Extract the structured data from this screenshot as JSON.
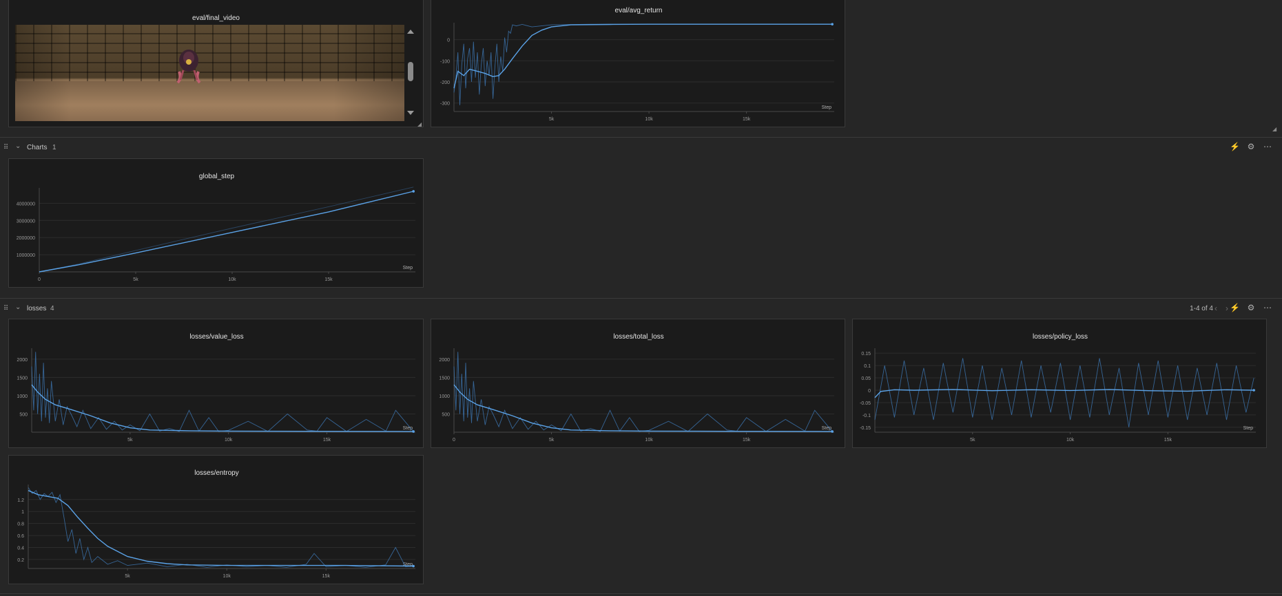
{
  "sections": {
    "charts": {
      "name": "Charts",
      "count": "1"
    },
    "losses": {
      "name": "losses",
      "count": "4",
      "pager": "1-4 of 4"
    }
  },
  "icons": {
    "drag": "drag-handle-icon",
    "collapse": "chevron-down-icon",
    "edit": "magic-wand-icon",
    "settings": "gear-icon",
    "more": "more-icon",
    "prev": "chevron-left-icon",
    "next": "chevron-right-icon"
  },
  "colors": {
    "line": "#5ba3e8",
    "raw": "#3d78b5",
    "background": "#262626",
    "panel": "#1b1b1b"
  },
  "video_panel": {
    "title": "eval/final_video"
  },
  "chart_data": [
    {
      "id": "avg_return",
      "type": "line",
      "title": "eval/avg_return",
      "xlabel": "Step",
      "xlim": [
        0,
        19500
      ],
      "ylim": [
        -340,
        80
      ],
      "xticks": [
        "5k",
        "10k",
        "15k"
      ],
      "xtick_values": [
        5000,
        10000,
        15000
      ],
      "yticks": [
        "0",
        "-100",
        "-200",
        "-300"
      ],
      "ytick_values": [
        0,
        -100,
        -200,
        -300
      ],
      "series": [
        {
          "role": "smoothed",
          "x": [
            0,
            200,
            500,
            800,
            1200,
            1600,
            2000,
            2300,
            2600,
            3000,
            3500,
            4000,
            4500,
            5000,
            6000,
            8000,
            10000,
            13000,
            16000,
            19400
          ],
          "y": [
            -230,
            -150,
            -170,
            -140,
            -150,
            -160,
            -175,
            -170,
            -140,
            -90,
            -30,
            20,
            45,
            60,
            70,
            72,
            73,
            73,
            73,
            73
          ]
        },
        {
          "role": "raw",
          "x": [
            0,
            100,
            200,
            300,
            400,
            500,
            600,
            700,
            800,
            900,
            1000,
            1100,
            1200,
            1300,
            1400,
            1500,
            1600,
            1700,
            1800,
            1900,
            2000,
            2100,
            2200,
            2300,
            2400,
            2500,
            2600,
            2700,
            2800,
            2900,
            3000,
            3200,
            3500,
            4000,
            5000,
            7000,
            10000,
            14000,
            19400
          ],
          "y": [
            -250,
            -180,
            -60,
            -310,
            -120,
            -20,
            -230,
            -90,
            -40,
            -200,
            -10,
            -180,
            -60,
            -260,
            -120,
            -40,
            -220,
            -100,
            -170,
            -60,
            -280,
            -130,
            -20,
            -200,
            -80,
            -150,
            10,
            -60,
            40,
            30,
            70,
            65,
            72,
            60,
            70,
            73,
            73,
            73,
            73
          ]
        }
      ]
    },
    {
      "id": "global_step",
      "type": "line",
      "title": "global_step",
      "xlabel": "Step",
      "xlim": [
        0,
        19500
      ],
      "ylim": [
        0,
        4900000
      ],
      "xticks": [
        "0",
        "5k",
        "10k",
        "15k"
      ],
      "xtick_values": [
        0,
        5000,
        10000,
        15000
      ],
      "yticks": [
        "4000000",
        "3000000",
        "2000000",
        "1000000"
      ],
      "ytick_values": [
        4000000,
        3000000,
        2000000,
        1000000
      ],
      "series": [
        {
          "role": "smoothed",
          "x": [
            0,
            2000,
            5000,
            10000,
            15000,
            19400
          ],
          "y": [
            0,
            400000,
            1100000,
            2300000,
            3500000,
            4700000
          ]
        },
        {
          "role": "raw",
          "x": [
            0,
            2000,
            5000,
            10000,
            15000,
            19400
          ],
          "y": [
            0,
            450000,
            1250000,
            2550000,
            3800000,
            4950000
          ]
        }
      ]
    },
    {
      "id": "value_loss",
      "type": "line",
      "title": "losses/value_loss",
      "xlabel": "Step",
      "xlim": [
        0,
        19500
      ],
      "ylim": [
        0,
        2300
      ],
      "xticks": [
        "5k",
        "10k",
        "15k"
      ],
      "xtick_values": [
        5000,
        10000,
        15000
      ],
      "yticks": [
        "2000",
        "1500",
        "1000",
        "500"
      ],
      "ytick_values": [
        2000,
        1500,
        1000,
        500
      ],
      "series": [
        {
          "role": "smoothed",
          "x": [
            0,
            300,
            700,
            1200,
            2000,
            3000,
            4000,
            5000,
            6000,
            8000,
            10000,
            14000,
            19400
          ],
          "y": [
            1300,
            1100,
            900,
            750,
            620,
            450,
            250,
            120,
            60,
            40,
            30,
            25,
            20
          ]
        },
        {
          "role": "raw",
          "x": [
            0,
            100,
            200,
            300,
            400,
            500,
            600,
            700,
            800,
            900,
            1000,
            1200,
            1400,
            1600,
            1800,
            2000,
            2300,
            2600,
            3000,
            3400,
            3800,
            4200,
            4600,
            5000,
            5500,
            6000,
            6500,
            7000,
            7500,
            8000,
            8500,
            9000,
            9500,
            10000,
            11000,
            12000,
            13000,
            14000,
            14500,
            15000,
            16000,
            17000,
            18000,
            18500,
            19400
          ],
          "y": [
            1800,
            600,
            2200,
            500,
            1600,
            300,
            1900,
            400,
            1200,
            250,
            1400,
            300,
            900,
            200,
            700,
            500,
            150,
            600,
            100,
            400,
            80,
            300,
            60,
            200,
            40,
            500,
            30,
            100,
            20,
            600,
            30,
            400,
            20,
            50,
            300,
            20,
            500,
            60,
            30,
            400,
            20,
            350,
            30,
            600,
            20
          ]
        }
      ]
    },
    {
      "id": "total_loss",
      "type": "line",
      "title": "losses/total_loss",
      "xlabel": "Step",
      "xlim": [
        0,
        19500
      ],
      "ylim": [
        0,
        2300
      ],
      "xticks": [
        "0",
        "5k",
        "10k",
        "15k"
      ],
      "xtick_values": [
        0,
        5000,
        10000,
        15000
      ],
      "yticks": [
        "2000",
        "1500",
        "1000",
        "500"
      ],
      "ytick_values": [
        2000,
        1500,
        1000,
        500
      ],
      "series": [
        {
          "role": "smoothed",
          "x": [
            0,
            300,
            700,
            1200,
            2000,
            3000,
            4000,
            5000,
            6000,
            8000,
            10000,
            14000,
            19400
          ],
          "y": [
            1300,
            1100,
            900,
            750,
            620,
            450,
            250,
            120,
            60,
            40,
            30,
            25,
            20
          ]
        },
        {
          "role": "raw",
          "x": [
            0,
            100,
            200,
            300,
            400,
            500,
            600,
            700,
            800,
            900,
            1000,
            1200,
            1400,
            1600,
            1800,
            2000,
            2300,
            2600,
            3000,
            3400,
            3800,
            4200,
            4600,
            5000,
            5500,
            6000,
            6500,
            7000,
            7500,
            8000,
            8500,
            9000,
            9500,
            10000,
            11000,
            12000,
            13000,
            14000,
            14500,
            15000,
            16000,
            17000,
            18000,
            18500,
            19400
          ],
          "y": [
            1800,
            600,
            2200,
            500,
            1600,
            300,
            1900,
            400,
            1200,
            250,
            1400,
            300,
            900,
            200,
            700,
            500,
            150,
            600,
            100,
            400,
            80,
            300,
            60,
            200,
            40,
            500,
            30,
            100,
            20,
            600,
            30,
            400,
            20,
            50,
            300,
            20,
            500,
            60,
            30,
            400,
            20,
            350,
            30,
            600,
            20
          ]
        }
      ]
    },
    {
      "id": "policy_loss",
      "type": "line",
      "title": "losses/policy_loss",
      "xlabel": "Step",
      "xlim": [
        0,
        19500
      ],
      "ylim": [
        -0.17,
        0.17
      ],
      "xticks": [
        "5k",
        "10k",
        "15k"
      ],
      "xtick_values": [
        5000,
        10000,
        15000
      ],
      "yticks": [
        "0.15",
        "0.1",
        "0.05",
        "0",
        "-0.05",
        "-0.1",
        "-0.15"
      ],
      "ytick_values": [
        0.15,
        0.1,
        0.05,
        0,
        -0.05,
        -0.1,
        -0.15
      ],
      "series": [
        {
          "role": "smoothed",
          "x": [
            0,
            300,
            1000,
            2000,
            4000,
            6000,
            8000,
            10000,
            12000,
            14000,
            16000,
            18000,
            19400
          ],
          "y": [
            -0.03,
            -0.005,
            0.002,
            0,
            0.003,
            -0.002,
            0.002,
            -0.001,
            0.003,
            -0.002,
            -0.004,
            0.002,
            0
          ]
        },
        {
          "role": "raw",
          "x": [
            0,
            500,
            1000,
            1500,
            2000,
            2500,
            3000,
            3500,
            4000,
            4500,
            5000,
            5500,
            6000,
            6500,
            7000,
            7500,
            8000,
            8500,
            9000,
            9500,
            10000,
            10500,
            11000,
            11500,
            12000,
            12500,
            13000,
            13500,
            14000,
            14500,
            15000,
            15500,
            16000,
            16500,
            17000,
            17500,
            18000,
            18500,
            19000,
            19400
          ],
          "y": [
            -0.12,
            0.1,
            -0.11,
            0.12,
            -0.1,
            0.09,
            -0.12,
            0.11,
            -0.09,
            0.13,
            -0.11,
            0.1,
            -0.12,
            0.09,
            -0.1,
            0.12,
            -0.11,
            0.1,
            -0.09,
            0.11,
            -0.12,
            0.1,
            -0.11,
            0.13,
            -0.1,
            0.09,
            -0.15,
            0.11,
            -0.1,
            0.12,
            -0.11,
            0.1,
            -0.12,
            0.09,
            -0.1,
            0.11,
            -0.12,
            0.1,
            -0.09,
            0.05
          ]
        }
      ]
    },
    {
      "id": "entropy",
      "type": "line",
      "title": "losses/entropy",
      "xlabel": "Step",
      "xlim": [
        0,
        19500
      ],
      "ylim": [
        0.05,
        1.45
      ],
      "xticks": [
        "5k",
        "10k",
        "15k"
      ],
      "xtick_values": [
        5000,
        10000,
        15000
      ],
      "yticks": [
        "1.2",
        "1",
        "0.8",
        "0.6",
        "0.4",
        "0.2"
      ],
      "ytick_values": [
        1.2,
        1,
        0.8,
        0.6,
        0.4,
        0.2
      ],
      "series": [
        {
          "role": "smoothed",
          "x": [
            0,
            500,
            1000,
            1500,
            2000,
            2500,
            3000,
            3500,
            4000,
            5000,
            6000,
            7000,
            8000,
            10000,
            13000,
            16000,
            19400
          ],
          "y": [
            1.35,
            1.28,
            1.25,
            1.22,
            1.1,
            0.9,
            0.72,
            0.55,
            0.42,
            0.25,
            0.17,
            0.13,
            0.11,
            0.1,
            0.1,
            0.1,
            0.09
          ]
        },
        {
          "role": "raw",
          "x": [
            0,
            200,
            400,
            600,
            800,
            1000,
            1200,
            1400,
            1600,
            1800,
            2000,
            2200,
            2400,
            2600,
            2800,
            3000,
            3200,
            3500,
            4000,
            4500,
            5000,
            6000,
            7000,
            8000,
            9000,
            10000,
            11000,
            12000,
            13000,
            14000,
            14400,
            15000,
            16000,
            17000,
            18000,
            18500,
            19000,
            19400
          ],
          "y": [
            1.4,
            1.3,
            1.35,
            1.2,
            1.3,
            1.25,
            1.32,
            1.15,
            1.28,
            0.9,
            0.5,
            0.7,
            0.3,
            0.55,
            0.2,
            0.4,
            0.15,
            0.25,
            0.12,
            0.18,
            0.1,
            0.14,
            0.08,
            0.12,
            0.07,
            0.11,
            0.08,
            0.1,
            0.07,
            0.12,
            0.3,
            0.08,
            0.1,
            0.07,
            0.11,
            0.4,
            0.08,
            0.09
          ]
        }
      ]
    }
  ]
}
